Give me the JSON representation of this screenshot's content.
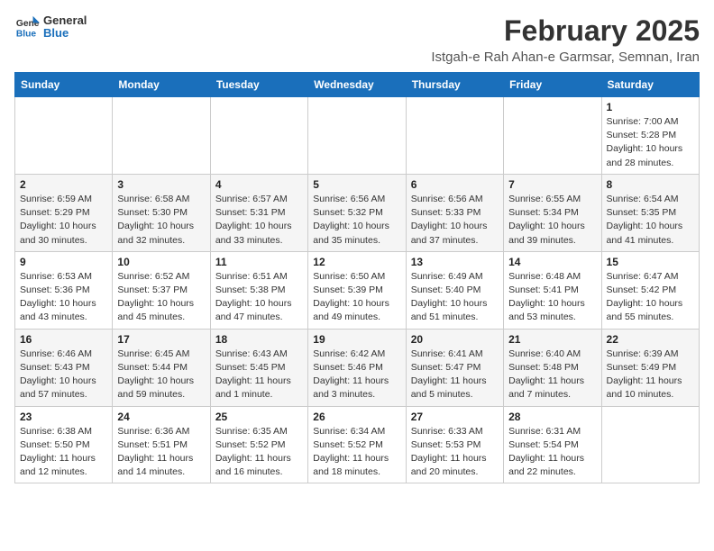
{
  "logo": {
    "line1": "General",
    "line2": "Blue"
  },
  "title": "February 2025",
  "location": "Istgah-e Rah Ahan-e Garmsar, Semnan, Iran",
  "weekdays": [
    "Sunday",
    "Monday",
    "Tuesday",
    "Wednesday",
    "Thursday",
    "Friday",
    "Saturday"
  ],
  "weeks": [
    [
      {
        "day": "",
        "info": ""
      },
      {
        "day": "",
        "info": ""
      },
      {
        "day": "",
        "info": ""
      },
      {
        "day": "",
        "info": ""
      },
      {
        "day": "",
        "info": ""
      },
      {
        "day": "",
        "info": ""
      },
      {
        "day": "1",
        "info": "Sunrise: 7:00 AM\nSunset: 5:28 PM\nDaylight: 10 hours\nand 28 minutes."
      }
    ],
    [
      {
        "day": "2",
        "info": "Sunrise: 6:59 AM\nSunset: 5:29 PM\nDaylight: 10 hours\nand 30 minutes."
      },
      {
        "day": "3",
        "info": "Sunrise: 6:58 AM\nSunset: 5:30 PM\nDaylight: 10 hours\nand 32 minutes."
      },
      {
        "day": "4",
        "info": "Sunrise: 6:57 AM\nSunset: 5:31 PM\nDaylight: 10 hours\nand 33 minutes."
      },
      {
        "day": "5",
        "info": "Sunrise: 6:56 AM\nSunset: 5:32 PM\nDaylight: 10 hours\nand 35 minutes."
      },
      {
        "day": "6",
        "info": "Sunrise: 6:56 AM\nSunset: 5:33 PM\nDaylight: 10 hours\nand 37 minutes."
      },
      {
        "day": "7",
        "info": "Sunrise: 6:55 AM\nSunset: 5:34 PM\nDaylight: 10 hours\nand 39 minutes."
      },
      {
        "day": "8",
        "info": "Sunrise: 6:54 AM\nSunset: 5:35 PM\nDaylight: 10 hours\nand 41 minutes."
      }
    ],
    [
      {
        "day": "9",
        "info": "Sunrise: 6:53 AM\nSunset: 5:36 PM\nDaylight: 10 hours\nand 43 minutes."
      },
      {
        "day": "10",
        "info": "Sunrise: 6:52 AM\nSunset: 5:37 PM\nDaylight: 10 hours\nand 45 minutes."
      },
      {
        "day": "11",
        "info": "Sunrise: 6:51 AM\nSunset: 5:38 PM\nDaylight: 10 hours\nand 47 minutes."
      },
      {
        "day": "12",
        "info": "Sunrise: 6:50 AM\nSunset: 5:39 PM\nDaylight: 10 hours\nand 49 minutes."
      },
      {
        "day": "13",
        "info": "Sunrise: 6:49 AM\nSunset: 5:40 PM\nDaylight: 10 hours\nand 51 minutes."
      },
      {
        "day": "14",
        "info": "Sunrise: 6:48 AM\nSunset: 5:41 PM\nDaylight: 10 hours\nand 53 minutes."
      },
      {
        "day": "15",
        "info": "Sunrise: 6:47 AM\nSunset: 5:42 PM\nDaylight: 10 hours\nand 55 minutes."
      }
    ],
    [
      {
        "day": "16",
        "info": "Sunrise: 6:46 AM\nSunset: 5:43 PM\nDaylight: 10 hours\nand 57 minutes."
      },
      {
        "day": "17",
        "info": "Sunrise: 6:45 AM\nSunset: 5:44 PM\nDaylight: 10 hours\nand 59 minutes."
      },
      {
        "day": "18",
        "info": "Sunrise: 6:43 AM\nSunset: 5:45 PM\nDaylight: 11 hours\nand 1 minute."
      },
      {
        "day": "19",
        "info": "Sunrise: 6:42 AM\nSunset: 5:46 PM\nDaylight: 11 hours\nand 3 minutes."
      },
      {
        "day": "20",
        "info": "Sunrise: 6:41 AM\nSunset: 5:47 PM\nDaylight: 11 hours\nand 5 minutes."
      },
      {
        "day": "21",
        "info": "Sunrise: 6:40 AM\nSunset: 5:48 PM\nDaylight: 11 hours\nand 7 minutes."
      },
      {
        "day": "22",
        "info": "Sunrise: 6:39 AM\nSunset: 5:49 PM\nDaylight: 11 hours\nand 10 minutes."
      }
    ],
    [
      {
        "day": "23",
        "info": "Sunrise: 6:38 AM\nSunset: 5:50 PM\nDaylight: 11 hours\nand 12 minutes."
      },
      {
        "day": "24",
        "info": "Sunrise: 6:36 AM\nSunset: 5:51 PM\nDaylight: 11 hours\nand 14 minutes."
      },
      {
        "day": "25",
        "info": "Sunrise: 6:35 AM\nSunset: 5:52 PM\nDaylight: 11 hours\nand 16 minutes."
      },
      {
        "day": "26",
        "info": "Sunrise: 6:34 AM\nSunset: 5:52 PM\nDaylight: 11 hours\nand 18 minutes."
      },
      {
        "day": "27",
        "info": "Sunrise: 6:33 AM\nSunset: 5:53 PM\nDaylight: 11 hours\nand 20 minutes."
      },
      {
        "day": "28",
        "info": "Sunrise: 6:31 AM\nSunset: 5:54 PM\nDaylight: 11 hours\nand 22 minutes."
      },
      {
        "day": "",
        "info": ""
      }
    ]
  ]
}
